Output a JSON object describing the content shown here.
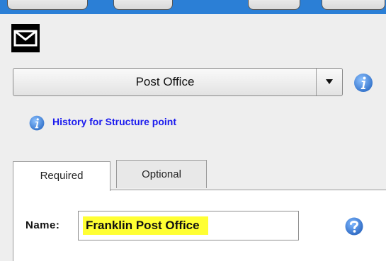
{
  "feature_type": {
    "selected": "Post Office"
  },
  "history": {
    "label": "History for Structure point"
  },
  "tabs": [
    {
      "label": "Required"
    },
    {
      "label": "Optional"
    }
  ],
  "fields": {
    "name": {
      "label": "Name:",
      "value": "Franklin Post Office"
    }
  },
  "icons": {
    "envelope": "envelope-icon",
    "info": "info-icon",
    "help": "help-icon",
    "dropdown": "chevron-down-icon"
  },
  "colors": {
    "top_bar": "#2b7fd6",
    "link": "#1a1aee",
    "highlight": "#ffff33",
    "info_icon": "#3b82d8"
  }
}
